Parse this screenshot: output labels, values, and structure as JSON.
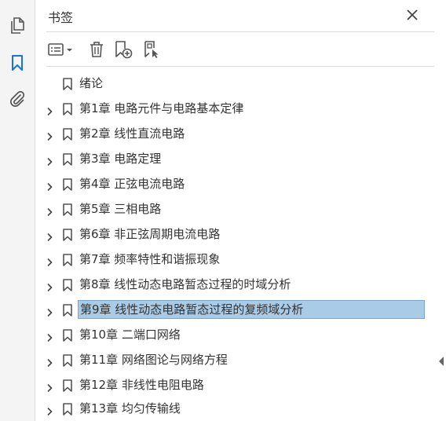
{
  "panel": {
    "title": "书签"
  },
  "rail": {
    "items": [
      {
        "icon": "copy-pages-icon"
      },
      {
        "icon": "bookmark-icon",
        "active": true
      },
      {
        "icon": "paperclip-icon"
      }
    ]
  },
  "toolbar": {
    "buttons": [
      {
        "icon": "options-menu-icon"
      },
      {
        "icon": "delete-trash-icon"
      },
      {
        "icon": "new-bookmark-icon"
      },
      {
        "icon": "bookmark-from-structure-icon"
      }
    ]
  },
  "bookmarks": [
    {
      "label": "绪论",
      "expandable": false
    },
    {
      "label": "第1章  电路元件与电路基本定律",
      "expandable": true
    },
    {
      "label": "第2章  线性直流电路",
      "expandable": true
    },
    {
      "label": "第3章  电路定理",
      "expandable": true
    },
    {
      "label": "第4章  正弦电流电路",
      "expandable": true
    },
    {
      "label": "第5章  三相电路",
      "expandable": true
    },
    {
      "label": "第6章  非正弦周期电流电路",
      "expandable": true
    },
    {
      "label": "第7章  频率特性和谐振现象",
      "expandable": true
    },
    {
      "label": "第8章  线性动态电路暂态过程的时域分析",
      "expandable": true
    },
    {
      "label": "第9章  线性动态电路暂态过程的复频域分析",
      "expandable": true,
      "selected": true
    },
    {
      "label": "第10章  二端口网络",
      "expandable": true
    },
    {
      "label": "第11章  网络图论与网络方程",
      "expandable": true
    },
    {
      "label": "第12章  非线性电阻电路",
      "expandable": true
    },
    {
      "label": "第13章  均匀传输线",
      "expandable": true
    }
  ],
  "colors": {
    "accent": "#1473e6",
    "selection": "#a9cbe6",
    "icon": "#555555"
  }
}
